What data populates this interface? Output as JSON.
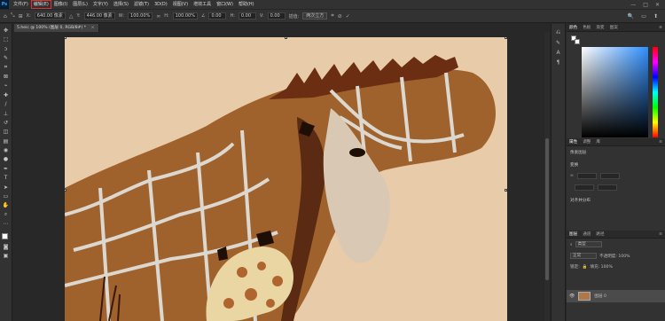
{
  "menubar": {
    "logo": "Ps",
    "items": [
      "文件(F)",
      "编辑(E)",
      "图像(I)",
      "图层(L)",
      "文字(Y)",
      "选择(S)",
      "滤镜(T)",
      "3D(D)",
      "视图(V)",
      "增效工具",
      "窗口(W)",
      "帮助(H)"
    ],
    "active_index": 1,
    "window_controls": [
      "—",
      "□",
      "✕"
    ]
  },
  "optbar": {
    "x_label": "X:",
    "x_value": "640.00 像素",
    "y_label": "Y:",
    "y_value": "446.00 像素",
    "w_label": "W:",
    "w_value": "100.00%",
    "h_label": "H:",
    "h_value": "100.00%",
    "angle_label": "∠",
    "angle_value": "0.00",
    "hskew_label": "H:",
    "hskew_value": "0.00",
    "vskew_label": "V:",
    "vskew_value": "0.00",
    "interp_label": "插值:",
    "interp_value": "两次立方",
    "cancel_icon": "⊘",
    "commit_icon": "✓",
    "right_icons": [
      "🔍",
      "▭",
      "⬆"
    ]
  },
  "document": {
    "tab_title": "5.heic @ 100% (图层 0, RGB/8#) *",
    "tab_close": "×"
  },
  "panels": {
    "color_tabs": [
      "颜色",
      "色板",
      "渐变",
      "图案"
    ],
    "properties_tabs": [
      "属性",
      "调整",
      "库"
    ],
    "properties_layer": "像素图层",
    "properties_transform": "变换",
    "properties_arrange": "对齐并分布",
    "layers_tabs": [
      "图层",
      "通道",
      "路径"
    ],
    "layers_kind": "类型",
    "layers_blend": "正常",
    "layers_opacity": "不透明度: 100%",
    "layers_lock": "锁定:",
    "layers_fill": "填充: 100%",
    "layer_name": "图层 0"
  },
  "colors": {
    "canvas_bg": "#e8cba8",
    "giraffe_brown": "#a0622c",
    "giraffe_dark": "#5a2a12",
    "giraffe_lines": "#dcd8cf",
    "accent_red": "#e03030"
  }
}
